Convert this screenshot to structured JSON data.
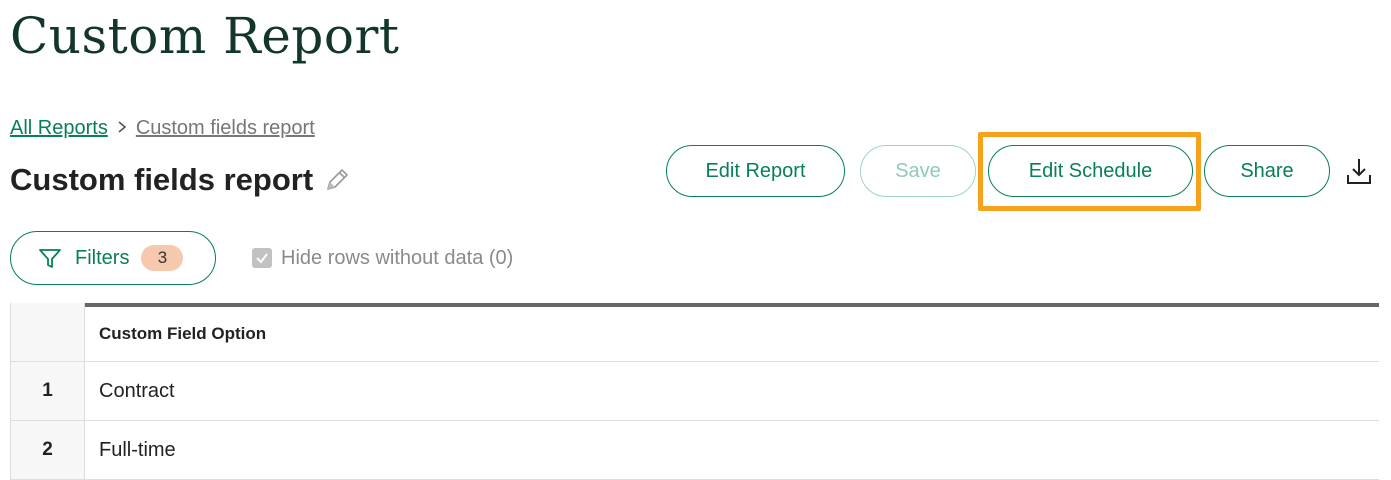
{
  "page": {
    "title": "Custom Report"
  },
  "breadcrumb": {
    "all_reports": "All Reports",
    "separator": ">",
    "current": "Custom fields report"
  },
  "report": {
    "title": "Custom fields report",
    "edit_icon": "pencil-icon"
  },
  "toolbar": {
    "edit_report_label": "Edit Report",
    "save_label": "Save",
    "save_disabled": true,
    "edit_schedule_label": "Edit Schedule",
    "edit_schedule_highlighted": true,
    "share_label": "Share",
    "download_icon": "download-icon"
  },
  "filters": {
    "label": "Filters",
    "count": "3",
    "icon": "funnel-icon"
  },
  "hide_rows": {
    "label": "Hide rows without data (0)",
    "checked": true,
    "disabled": true
  },
  "table": {
    "columns": [
      "",
      "Custom Field Option"
    ],
    "rows": [
      {
        "index": "1",
        "value": "Contract"
      },
      {
        "index": "2",
        "value": "Full-time"
      }
    ]
  },
  "colors": {
    "brand_green": "#087f5b",
    "title_dark_green": "#12372a",
    "highlight_orange": "#f7a21b",
    "badge_peach": "#f6c9ae"
  }
}
